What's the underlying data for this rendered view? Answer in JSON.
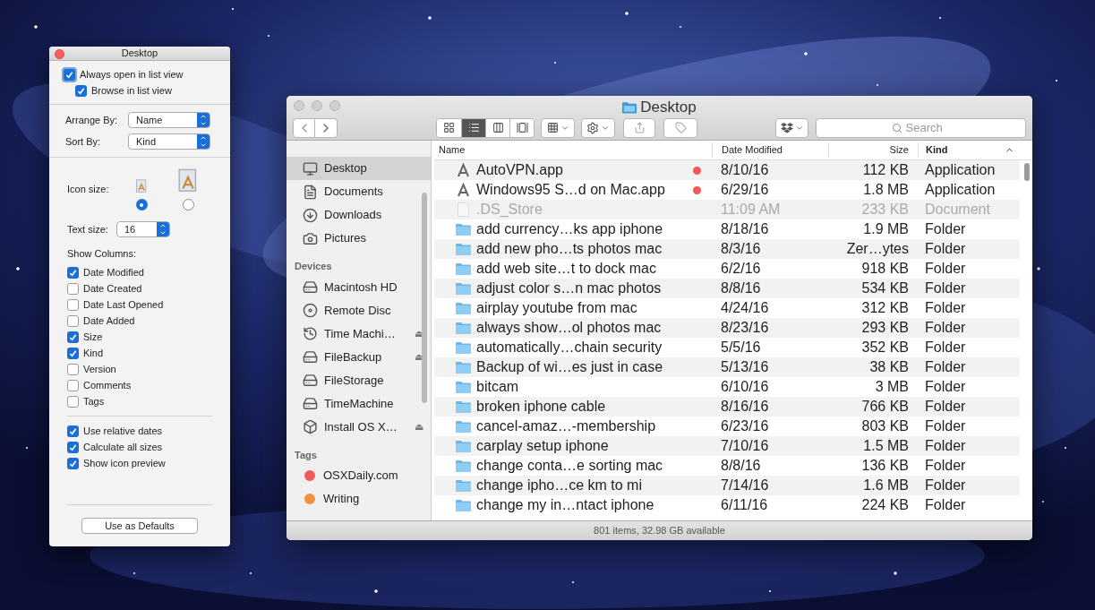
{
  "inspector": {
    "title": "Desktop",
    "top_options": [
      {
        "label": "Always open in list view",
        "checked": true,
        "focused": true
      },
      {
        "label": "Browse in list view",
        "checked": true,
        "focused": false
      }
    ],
    "arrange_by": {
      "label": "Arrange By:",
      "value": "Name"
    },
    "sort_by": {
      "label": "Sort By:",
      "value": "Kind"
    },
    "icon_size": {
      "label": "Icon size:",
      "options": [
        {
          "selected": true
        },
        {
          "selected": false
        }
      ]
    },
    "text_size": {
      "label": "Text size:",
      "value": "16"
    },
    "show_columns": {
      "label": "Show Columns:",
      "items": [
        {
          "label": "Date Modified",
          "checked": true
        },
        {
          "label": "Date Created",
          "checked": false
        },
        {
          "label": "Date Last Opened",
          "checked": false
        },
        {
          "label": "Date Added",
          "checked": false
        },
        {
          "label": "Size",
          "checked": true
        },
        {
          "label": "Kind",
          "checked": true
        },
        {
          "label": "Version",
          "checked": false
        },
        {
          "label": "Comments",
          "checked": false
        },
        {
          "label": "Tags",
          "checked": false
        }
      ]
    },
    "bottom_options": [
      {
        "label": "Use relative dates",
        "checked": true
      },
      {
        "label": "Calculate all sizes",
        "checked": true
      },
      {
        "label": "Show icon preview",
        "checked": true
      }
    ],
    "defaults_button": "Use as Defaults"
  },
  "finder": {
    "title": "Desktop",
    "search": {
      "placeholder": "Search"
    },
    "view_modes": [
      {
        "kind": "icons",
        "selected": false
      },
      {
        "kind": "list",
        "selected": true
      },
      {
        "kind": "columns",
        "selected": false
      },
      {
        "kind": "coverflow",
        "selected": false
      }
    ],
    "sidebar": [
      {
        "items": [
          {
            "label": "Desktop",
            "kind": "desktop",
            "selected": true
          },
          {
            "label": "Documents",
            "kind": "documents",
            "selected": false
          },
          {
            "label": "Downloads",
            "kind": "downloads",
            "selected": false
          },
          {
            "label": "Pictures",
            "kind": "pictures",
            "selected": false
          }
        ]
      },
      {
        "section": "Devices",
        "items": [
          {
            "label": "Macintosh HD",
            "kind": "disk",
            "selected": false
          },
          {
            "label": "Remote Disc",
            "kind": "disc",
            "selected": false
          },
          {
            "label": "Time Machi…",
            "kind": "timemachine",
            "selected": false,
            "eject": "⏏"
          },
          {
            "label": "FileBackup",
            "kind": "disk",
            "selected": false,
            "eject": "⏏"
          },
          {
            "label": "FileStorage",
            "kind": "disk",
            "selected": false
          },
          {
            "label": "TimeMachine",
            "kind": "disk",
            "selected": false
          },
          {
            "label": "Install OS X…",
            "kind": "drive",
            "selected": false,
            "eject": "⏏"
          }
        ]
      },
      {
        "section": "Tags",
        "items": [
          {
            "label": "OSXDaily.com",
            "kind": "tag",
            "color": "#f05a5a",
            "selected": false
          },
          {
            "label": "Writing",
            "kind": "tag",
            "color": "#f0913c",
            "selected": false
          }
        ]
      }
    ],
    "table": {
      "columns": [
        {
          "label": "Name",
          "sorted": false
        },
        {
          "label": "Date Modified",
          "sorted": false
        },
        {
          "label": "Size",
          "sorted": false
        },
        {
          "label": "Kind",
          "sorted": true
        }
      ],
      "rows": [
        {
          "kind": "app",
          "name": "AutoVPN.app",
          "color": "#f05a5a",
          "date": "8/10/16",
          "size": "112 KB",
          "type": "Application",
          "hidden": false
        },
        {
          "kind": "app",
          "name": "Windows95 S…d on Mac.app",
          "color": "#f05a5a",
          "date": "6/29/16",
          "size": "1.8 MB",
          "type": "Application",
          "hidden": false
        },
        {
          "kind": "file",
          "name": ".DS_Store",
          "date": "11:09 AM",
          "size": "233 KB",
          "type": "Document",
          "hidden": true
        },
        {
          "kind": "folder",
          "name": "add currency…ks app iphone",
          "date": "8/18/16",
          "size": "1.9 MB",
          "type": "Folder",
          "hidden": false
        },
        {
          "kind": "folder",
          "name": "add new pho…ts photos mac",
          "date": "8/3/16",
          "size": "Zer…ytes",
          "type": "Folder",
          "hidden": false
        },
        {
          "kind": "folder",
          "name": "add web site…t to dock mac",
          "date": "6/2/16",
          "size": "918 KB",
          "type": "Folder",
          "hidden": false
        },
        {
          "kind": "folder",
          "name": "adjust color s…n mac photos",
          "date": "8/8/16",
          "size": "534 KB",
          "type": "Folder",
          "hidden": false
        },
        {
          "kind": "folder",
          "name": "airplay youtube from mac",
          "date": "4/24/16",
          "size": "312 KB",
          "type": "Folder",
          "hidden": false
        },
        {
          "kind": "folder",
          "name": "always show…ol photos mac",
          "date": "8/23/16",
          "size": "293 KB",
          "type": "Folder",
          "hidden": false
        },
        {
          "kind": "folder",
          "name": "automatically…chain security",
          "date": "5/5/16",
          "size": "352 KB",
          "type": "Folder",
          "hidden": false
        },
        {
          "kind": "folder",
          "name": "Backup of wi…es just in case",
          "date": "5/13/16",
          "size": "38 KB",
          "type": "Folder",
          "hidden": false
        },
        {
          "kind": "folder",
          "name": "bitcam",
          "date": "6/10/16",
          "size": "3 MB",
          "type": "Folder",
          "hidden": false
        },
        {
          "kind": "folder",
          "name": "broken iphone cable",
          "date": "8/16/16",
          "size": "766 KB",
          "type": "Folder",
          "hidden": false
        },
        {
          "kind": "folder",
          "name": "cancel-amaz…-membership",
          "date": "6/23/16",
          "size": "803 KB",
          "type": "Folder",
          "hidden": false
        },
        {
          "kind": "folder",
          "name": "carplay setup iphone",
          "date": "7/10/16",
          "size": "1.5 MB",
          "type": "Folder",
          "hidden": false
        },
        {
          "kind": "folder",
          "name": "change conta…e sorting mac",
          "date": "8/8/16",
          "size": "136 KB",
          "type": "Folder",
          "hidden": false
        },
        {
          "kind": "folder",
          "name": "change ipho…ce km to mi",
          "date": "7/14/16",
          "size": "1.6 MB",
          "type": "Folder",
          "hidden": false
        },
        {
          "kind": "folder",
          "name": "change my in…ntact iphone",
          "date": "6/11/16",
          "size": "224 KB",
          "type": "Folder",
          "hidden": false
        }
      ]
    },
    "status_bar": "801 items, 32.98 GB available"
  }
}
